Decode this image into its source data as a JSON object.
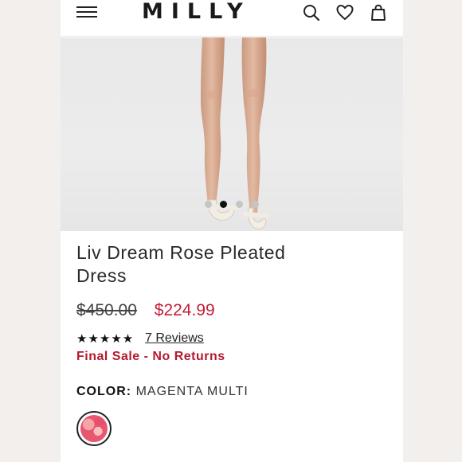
{
  "header": {
    "brand": "MILLY",
    "icons": [
      "menu-icon",
      "search-icon",
      "heart-icon",
      "bag-icon"
    ]
  },
  "carousel": {
    "slide_count": 4,
    "active_index": 1
  },
  "product": {
    "title": "Liv Dream Rose Pleated Dress",
    "original_price": "$450.00",
    "sale_price": "$224.99",
    "rating_stars": "★★★★★",
    "reviews_label": "7 Reviews",
    "final_sale_label": "Final Sale - No Returns",
    "color_label": "COLOR:",
    "color_value": "MAGENTA MULTI"
  },
  "colors": {
    "sale_red": "#c41e3a",
    "final_sale_red": "#b51a2e",
    "swatch_magenta": "#e8566f"
  }
}
